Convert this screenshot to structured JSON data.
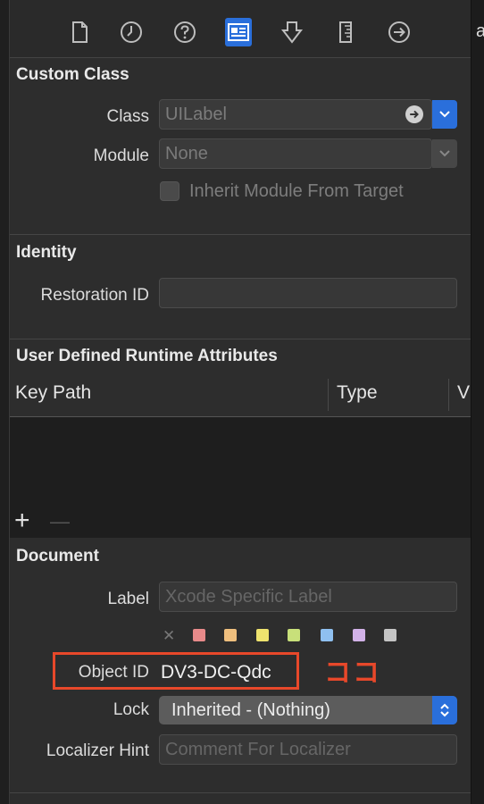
{
  "edge_char": "a",
  "toolbar": {
    "icons": [
      "file-icon",
      "clock-icon",
      "help-icon",
      "identity-icon",
      "attributes-icon",
      "size-icon",
      "connections-icon"
    ],
    "active": "identity-icon"
  },
  "custom_class": {
    "title": "Custom Class",
    "class_label": "Class",
    "class_value": "UILabel",
    "module_label": "Module",
    "module_value": "None",
    "inherit_label": "Inherit Module From Target"
  },
  "identity": {
    "title": "Identity",
    "restoration_label": "Restoration ID",
    "restoration_value": ""
  },
  "runtime": {
    "title": "User Defined Runtime Attributes",
    "columns": [
      "Key Path",
      "Type",
      "V"
    ],
    "add_symbol": "+",
    "remove_symbol": "—"
  },
  "document": {
    "title": "Document",
    "label_label": "Label",
    "label_placeholder": "Xcode Specific Label",
    "clear_symbol": "✕",
    "swatch_colors": [
      "#e88a8a",
      "#efbf7e",
      "#eee36e",
      "#c8e07a",
      "#8fc0f0",
      "#d2b2e8",
      "#c4c4c4"
    ],
    "object_id_label": "Object ID",
    "object_id_value": "DV3-DC-Qdc",
    "lock_label": "Lock",
    "lock_value": "Inherited - (Nothing)",
    "hint_label": "Localizer Hint",
    "hint_placeholder": "Comment For Localizer"
  },
  "annotation": {
    "text": "ココ",
    "color": "#e8482a"
  }
}
